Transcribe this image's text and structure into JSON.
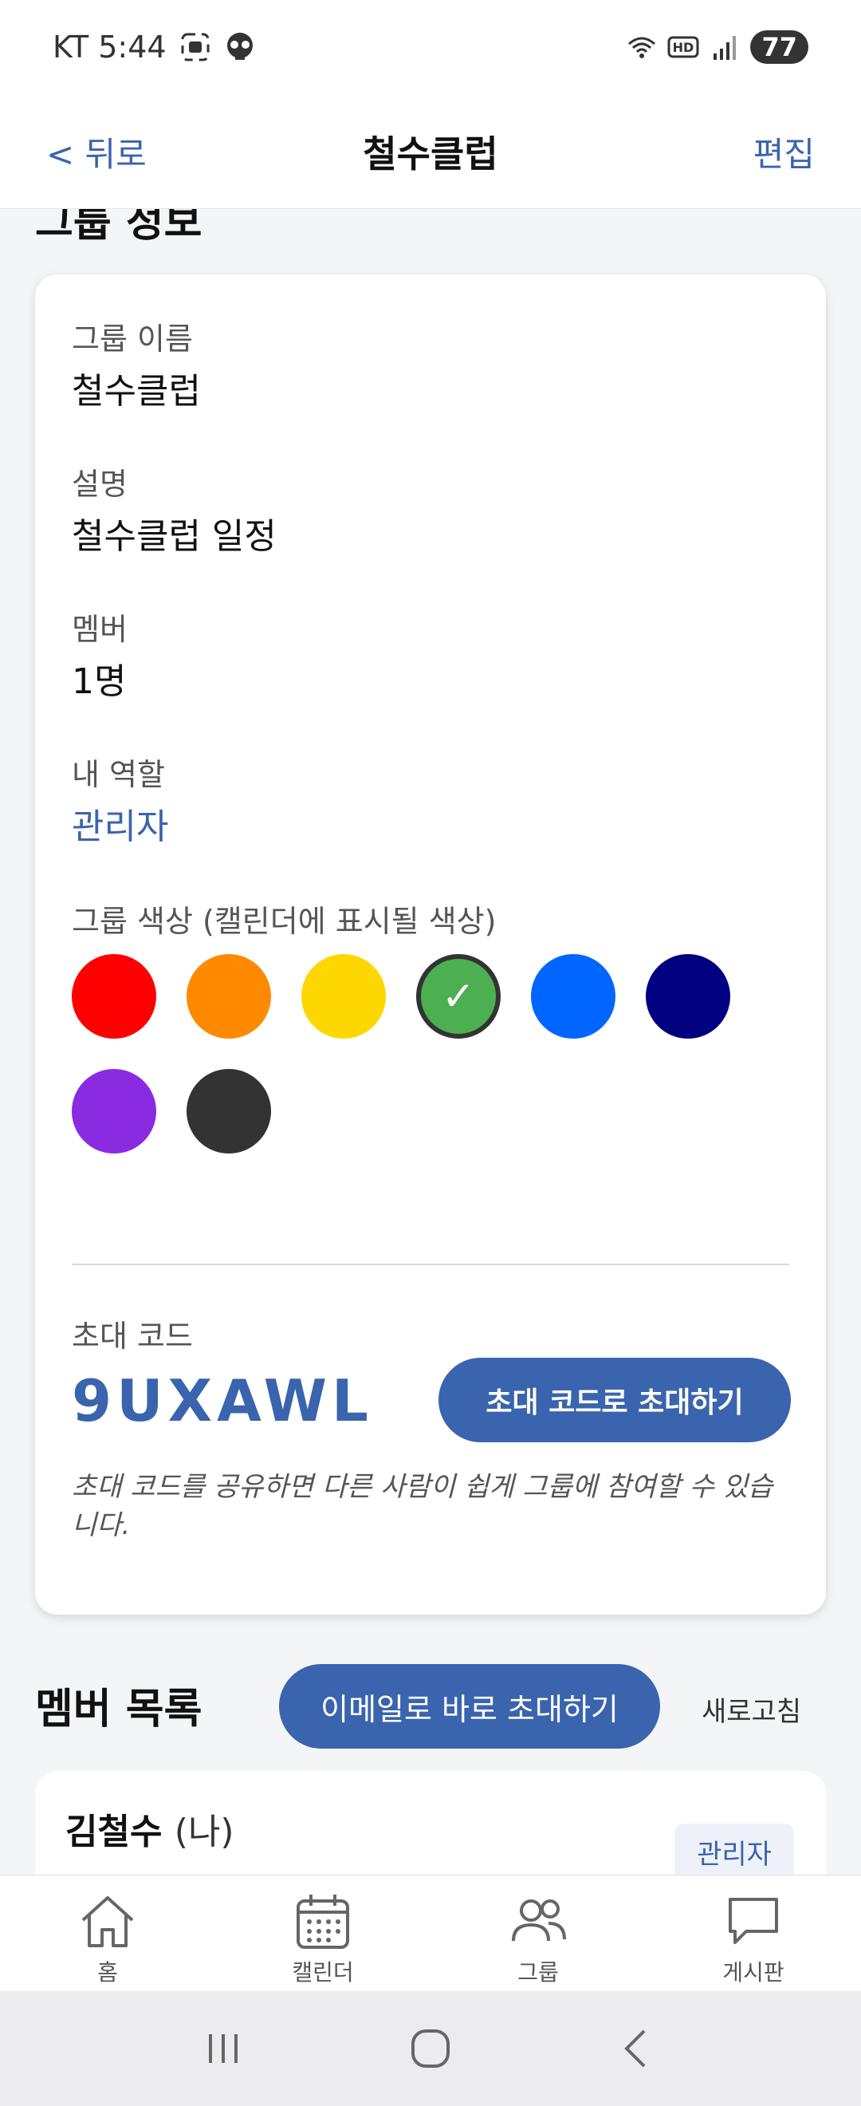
{
  "status_bar": {
    "carrier_time": "KT 5:44",
    "battery": "77",
    "icons": [
      "screenshot-icon",
      "skull-icon",
      "wifi-icon",
      "hd-icon",
      "signal-icon",
      "battery-icon"
    ]
  },
  "header": {
    "back_label": "< 뒤로",
    "title": "철수클럽",
    "edit_label": "편집"
  },
  "group_info": {
    "section_title": "그룹 정보",
    "name_label": "그룹 이름",
    "name_value": "철수클럽",
    "description_label": "설명",
    "description_value": "철수클럽 일정",
    "members_label": "멤버",
    "members_value": "1명",
    "role_label": "내 역할",
    "role_value": "관리자",
    "color_label": "그룹 색상 (캘린더에 표시될 색상)",
    "colors": [
      {
        "hex": "#ff0000",
        "selected": false
      },
      {
        "hex": "#ff8a00",
        "selected": false
      },
      {
        "hex": "#ffd700",
        "selected": false
      },
      {
        "hex": "#4caf50",
        "selected": true,
        "check": "✓"
      },
      {
        "hex": "#0066ff",
        "selected": false
      },
      {
        "hex": "#000080",
        "selected": false
      },
      {
        "hex": "#8a2be2",
        "selected": false
      },
      {
        "hex": "#333333",
        "selected": false
      }
    ],
    "invite_label": "초대 코드",
    "invite_code": "9UXAWL",
    "invite_button": "초대 코드로 초대하기",
    "invite_note": "초대 코드를 공유하면 다른 사람이 쉽게 그룹에 참여할 수 있습니다."
  },
  "members": {
    "section_title": "멤버 목록",
    "email_invite_button": "이메일로 바로 초대하기",
    "refresh_label": "새로고침",
    "list": [
      {
        "name": "김철수",
        "suffix": "(나)",
        "role": "관리자"
      }
    ]
  },
  "tabs": [
    {
      "label": "홈",
      "icon": "home-icon"
    },
    {
      "label": "캘린더",
      "icon": "calendar-icon"
    },
    {
      "label": "그룹",
      "icon": "group-icon"
    },
    {
      "label": "게시판",
      "icon": "message-board-icon"
    }
  ],
  "colors": {
    "accent": "#3a64ad",
    "background": "#f4f5f7"
  }
}
